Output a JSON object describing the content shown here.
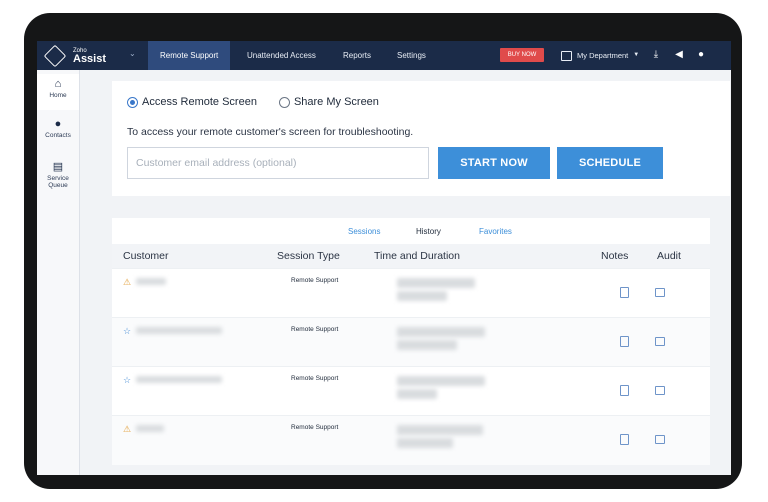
{
  "topbar": {
    "logo_zoho": "Zoho",
    "logo_assist": "Assist",
    "nav": [
      "Remote Support",
      "Unattended Access",
      "Reports",
      "Settings"
    ],
    "active_nav": "Remote Support",
    "buy_now": "BUY NOW",
    "department": "My Department"
  },
  "sidebar": {
    "items": [
      {
        "label": "Home",
        "icon": "home-icon"
      },
      {
        "label": "Contacts",
        "icon": "contacts-icon"
      },
      {
        "label": "Service Queue",
        "icon": "service-queue-icon"
      }
    ]
  },
  "session": {
    "option_remote": "Access Remote Screen",
    "option_share": "Share My Screen",
    "selected": "Access Remote Screen",
    "description": "To access your remote customer's screen for troubleshooting.",
    "email_placeholder": "Customer email address (optional)",
    "start_now": "START NOW",
    "schedule": "SCHEDULE"
  },
  "history": {
    "tabs": [
      "Sessions",
      "History",
      "Favorites"
    ],
    "active_tab": "History",
    "columns": [
      "Customer",
      "Session Type",
      "Time and Duration",
      "Notes",
      "Audit"
    ],
    "rows": [
      {
        "status_icon": "warning-icon",
        "session_type": "Remote Support"
      },
      {
        "status_icon": "star-icon",
        "session_type": "Remote Support"
      },
      {
        "status_icon": "star-icon",
        "session_type": "Remote Support"
      },
      {
        "status_icon": "warning-icon",
        "session_type": "Remote Support"
      }
    ]
  },
  "colors": {
    "topbar": "#1b2b48",
    "active_nav": "#2f4b7d",
    "primary_button": "#3d8fd9",
    "buy_now": "#e04b4b"
  }
}
